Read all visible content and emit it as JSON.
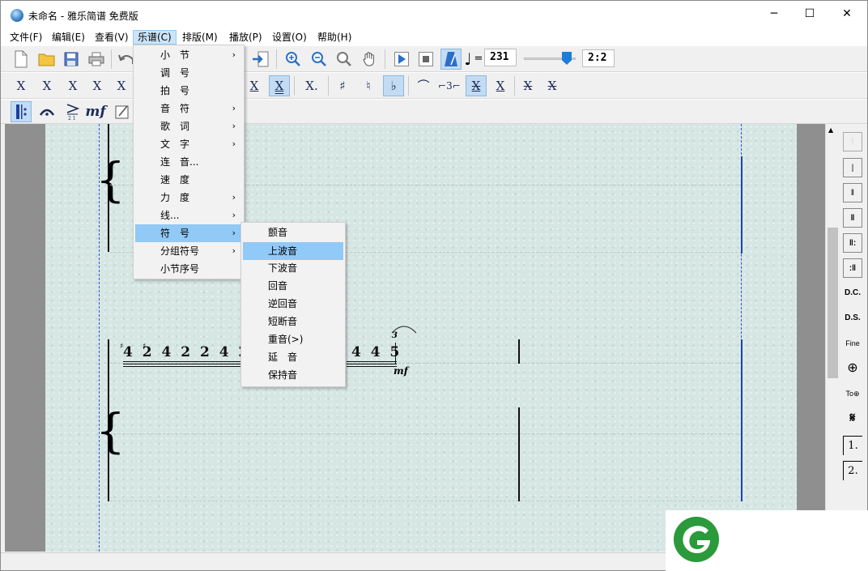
{
  "window": {
    "title": "未命名 - 雅乐简谱 免费版",
    "minimize": "─",
    "maximize": "☐",
    "close": "✕"
  },
  "menubar": [
    "文件(F)",
    "编辑(E)",
    "查看(V)",
    "乐谱(C)",
    "排版(M)",
    "播放(P)",
    "设置(O)",
    "帮助(H)"
  ],
  "toolbar": {
    "tempo_value": "231",
    "time_signature": "2:2",
    "equals": "=",
    "quarter_note": "♩"
  },
  "toolbar2_glyphs": [
    "X",
    "X",
    "X",
    "X",
    "X",
    "X",
    "X",
    "X.",
    "♯",
    "♮",
    "♭",
    "⌒",
    "⌐3⌐",
    "X",
    "X",
    "X",
    "X"
  ],
  "score": {
    "notes_left": "4 2 4 2 2 4 2",
    "notes_right": "4 4 5",
    "triplet_mark": "3",
    "dynamic": "mf",
    "sharp": "♯"
  },
  "menu_score": {
    "items": [
      {
        "label": "小　节",
        "submenu": true
      },
      {
        "label": "调　号",
        "submenu": false
      },
      {
        "label": "拍　号",
        "submenu": false
      },
      {
        "label": "音　符",
        "submenu": true
      },
      {
        "label": "歌　词",
        "submenu": true
      },
      {
        "label": "文　字",
        "submenu": true
      },
      {
        "label": "连　音...",
        "submenu": false
      },
      {
        "label": "速　度",
        "submenu": false
      },
      {
        "label": "力　度",
        "submenu": true
      },
      {
        "label": "线...",
        "submenu": true
      },
      {
        "label": "符　号",
        "submenu": true,
        "highlighted": true
      },
      {
        "label": "分组符号",
        "submenu": true
      },
      {
        "label": "小节序号",
        "submenu": false
      }
    ]
  },
  "submenu_symbols": {
    "items": [
      {
        "label": "颤音"
      },
      {
        "label": "上波音",
        "highlighted": true
      },
      {
        "label": "下波音"
      },
      {
        "label": "回音"
      },
      {
        "label": "逆回音"
      },
      {
        "label": "短断音"
      },
      {
        "label": "重音(>)"
      },
      {
        "label": "延　音"
      },
      {
        "label": "保持音"
      }
    ]
  },
  "palette": [
    "𝄀",
    "|",
    "‖",
    "‖",
    "‖:",
    ":‖",
    "D.C.",
    "D.S.",
    "Fine",
    "⊕",
    "To⊕",
    "𝄋",
    "1.",
    "2."
  ],
  "colors": {
    "accent": "#91c9f7",
    "paper": "#d6e6e3",
    "dash": "#2a4fd8",
    "logo": "#2a9a3a"
  }
}
